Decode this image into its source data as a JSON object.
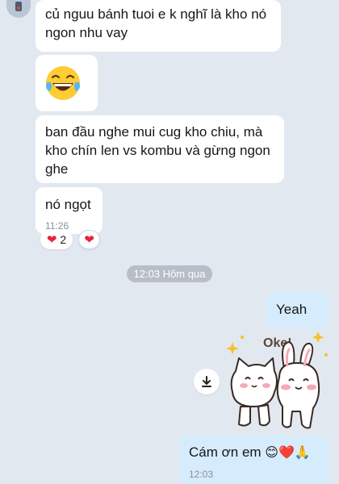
{
  "messages": [
    {
      "text_line1": "củ nguu bánh tuoi e k nghĩ là kho nó",
      "text_line2": "ngon nhu vay"
    },
    {
      "emoji": "laughing-tears"
    },
    {
      "text_line1": "ban đầu nghe mui cug kho chiu, mà",
      "text_line2": "kho chín len vs kombu và gừng ngon",
      "text_line3": "ghe"
    },
    {
      "text": "nó ngọt",
      "time": "11:26"
    }
  ],
  "reactions": [
    {
      "icon": "heart",
      "count": "2"
    },
    {
      "icon": "heart"
    }
  ],
  "date_separator": "12:03 Hôm qua",
  "outgoing": [
    {
      "text": "Yeah"
    },
    {
      "sticker_text": "Oke!"
    },
    {
      "text": "Cám ơn em",
      "emojis": "😊❤️🙏",
      "time": "12:03"
    }
  ],
  "colors": {
    "background": "#e2e8f0",
    "incoming_bubble": "#ffffff",
    "outgoing_bubble": "#d6ecfd",
    "reaction_heart": "#e5243b",
    "date_pill": "#b8bec8"
  }
}
